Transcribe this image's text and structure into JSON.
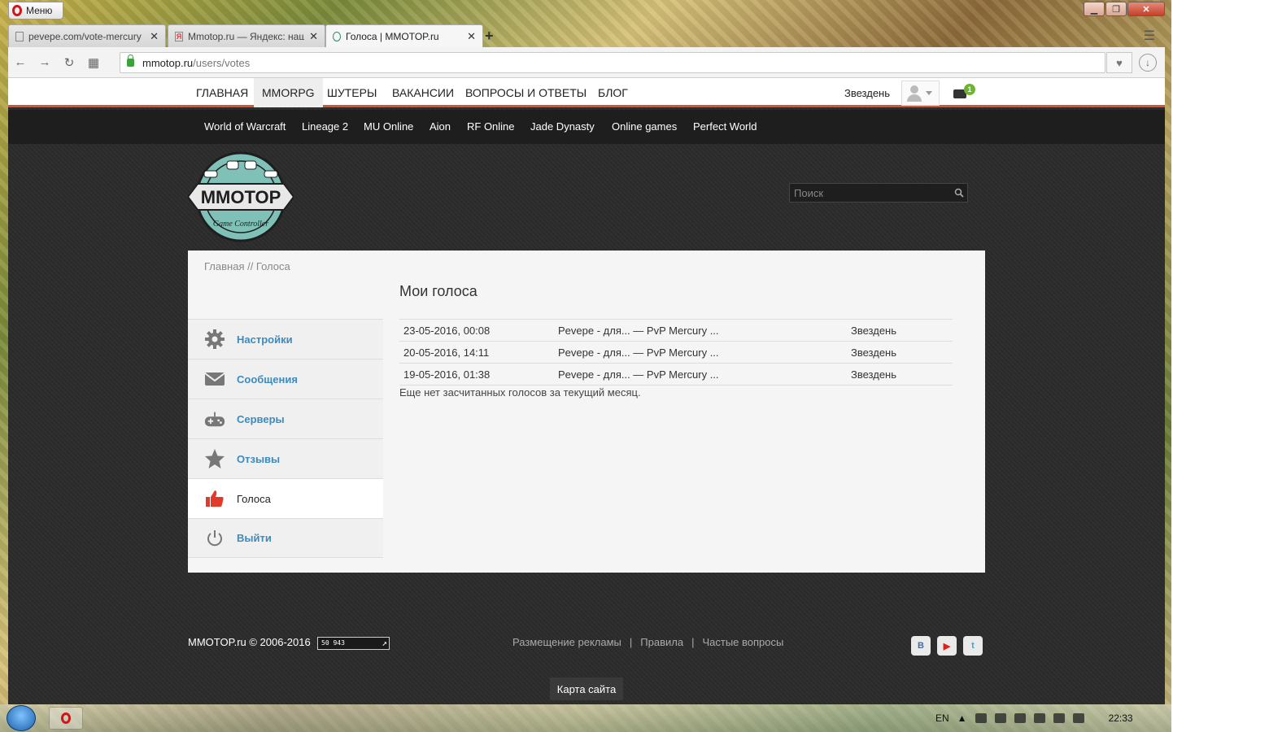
{
  "browser": {
    "menu_label": "Меню",
    "tabs": [
      {
        "label": "pevepe.com/vote-mercury",
        "active": false
      },
      {
        "label": "Mmotop.ru — Яндекс: наш",
        "active": false
      },
      {
        "label": "Голоса | MMOTOP.ru",
        "active": true
      }
    ],
    "url_host": "mmotop.ru",
    "url_path": "/users/votes"
  },
  "topnav": {
    "items": [
      "ГЛАВНАЯ",
      "MMORPG",
      "ШУТЕРЫ",
      "ВАКАНСИИ",
      "ВОПРОСЫ И ОТВЕТЫ",
      "БЛОГ"
    ],
    "active": "MMORPG",
    "username": "Звездень",
    "mail_count": "1"
  },
  "gamenav": {
    "items": [
      "World of Warcraft",
      "Lineage 2",
      "MU Online",
      "Aion",
      "RF Online",
      "Jade Dynasty",
      "Online games",
      "Perfect World"
    ]
  },
  "logo": {
    "text": "MMOTOP",
    "subtext": "Game Controller"
  },
  "search": {
    "placeholder": "Поиск"
  },
  "breadcrumb": "Главная // Голоса",
  "sidebar": {
    "items": [
      {
        "label": "Настройки",
        "icon": "gear-icon",
        "active": false
      },
      {
        "label": "Сообщения",
        "icon": "envelope-icon",
        "active": false
      },
      {
        "label": "Серверы",
        "icon": "gamepad-icon",
        "active": false
      },
      {
        "label": "Отзывы",
        "icon": "star-icon",
        "active": false
      },
      {
        "label": "Голоса",
        "icon": "thumbs-up-icon",
        "active": true
      },
      {
        "label": "Выйти",
        "icon": "power-icon",
        "active": false
      }
    ]
  },
  "main": {
    "title": "Мои голоса",
    "votes": [
      {
        "date": "23-05-2016, 00:08",
        "server": "Pevepe - для... — PvP Mercury ...",
        "user": "Звездень"
      },
      {
        "date": "20-05-2016, 14:11",
        "server": "Pevepe - для... — PvP Mercury ...",
        "user": "Звездень"
      },
      {
        "date": "19-05-2016, 01:38",
        "server": "Pevepe - для... — PvP Mercury ...",
        "user": "Звездень"
      }
    ],
    "note": "Еще нет засчитанных голосов за текущий месяц."
  },
  "footer": {
    "copyright": "MMOTOP.ru © 2006-2016",
    "counter": "50 943",
    "links": [
      "Размещение рекламы",
      "Правила",
      "Частые вопросы"
    ],
    "sitemap": "Карта сайта",
    "socials": [
      "В",
      "▶",
      "t"
    ]
  },
  "taskbar": {
    "lang": "EN",
    "time": "22:33"
  },
  "colors": {
    "accent": "#d9532c",
    "link": "#3b8bbf",
    "dark_bg": "#2b2b2b"
  }
}
